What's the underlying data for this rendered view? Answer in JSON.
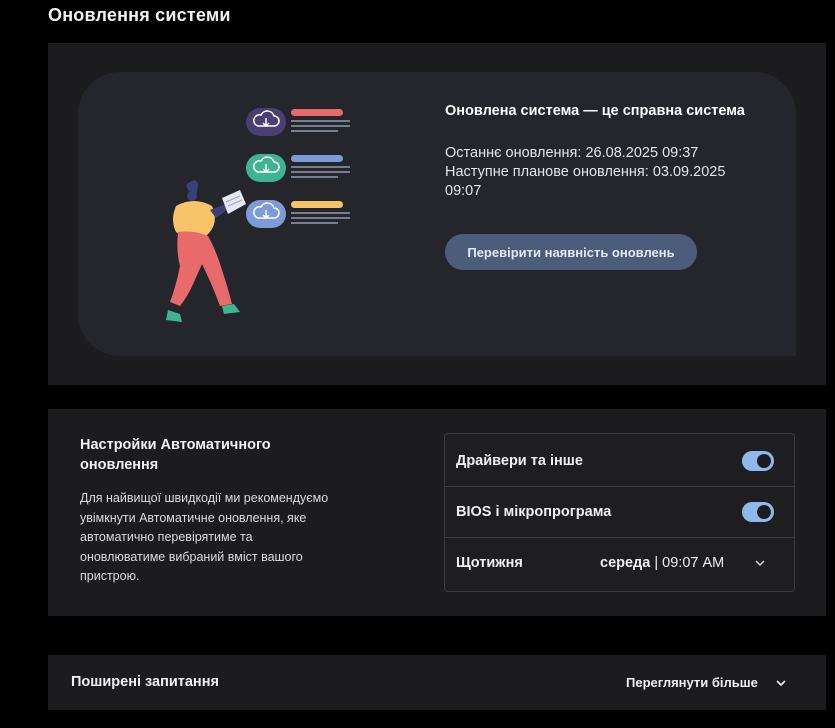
{
  "page": {
    "title": "Оновлення системи"
  },
  "hero": {
    "heading": "Оновлена система — це справна система",
    "last_update": "Останнє оновлення: 26.08.2025 09:37",
    "next_update_line1": "Наступне планове оновлення: 03.09.2025",
    "next_update_line2": "09:07",
    "check_button": "Перевірити наявність оновлень",
    "illustration": {
      "icons": [
        "cloud-download-icon",
        "cloud-download-icon",
        "cloud-download-icon"
      ],
      "colors": {
        "purple": "#4a3f73",
        "teal": "#3fb392",
        "blue": "#7d9bd6",
        "red": "#e86a6a",
        "yellow": "#f7c468"
      }
    }
  },
  "auto_update": {
    "title": "Настройки Автоматичного оновлення",
    "description": "Для найвищої швидкодії ми рекомендуємо увімкнути Автоматичне оновлення, яке автоматично перевірятиме та оновлюватиме вибраний вміст вашого пристрою.",
    "settings": [
      {
        "label": "Драйвери та інше",
        "enabled": true
      },
      {
        "label": "BIOS і мікропрограма",
        "enabled": true
      }
    ],
    "schedule": {
      "label": "Щотижня",
      "day": "середа",
      "separator": " | ",
      "time": "09:07 AM"
    }
  },
  "faq": {
    "title": "Поширені запитання",
    "more": "Переглянути більше"
  },
  "colors": {
    "background": "#000000",
    "panel": "#1c1c1e",
    "hero_inner": "#24262c",
    "button": "#4b5d7b",
    "toggle_on": "#8fb8ec"
  }
}
